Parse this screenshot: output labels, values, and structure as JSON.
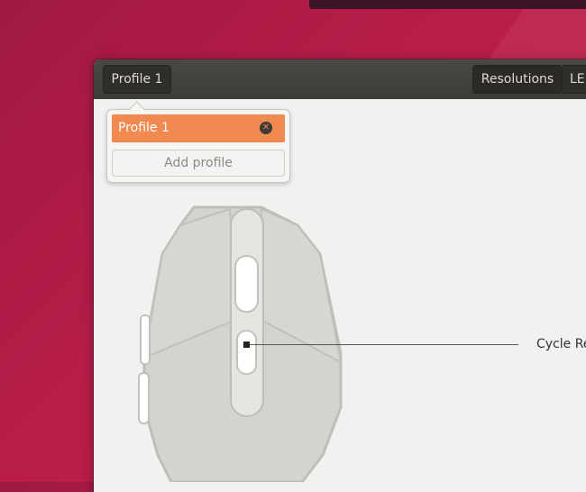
{
  "header": {
    "profile_button_label": "Profile 1",
    "resolutions_label": "Resolutions",
    "leds_label": "LE"
  },
  "profile_popover": {
    "profiles": [
      {
        "name": "Profile 1",
        "selected": true
      }
    ],
    "add_profile_label": "Add profile"
  },
  "mouse": {
    "callout_label": "Cycle Re"
  },
  "colors": {
    "desktop_background": "#b81d49",
    "headerbar": "#3c3b37",
    "selected_accent": "#f08a50",
    "window_background": "#f2f1f0"
  }
}
